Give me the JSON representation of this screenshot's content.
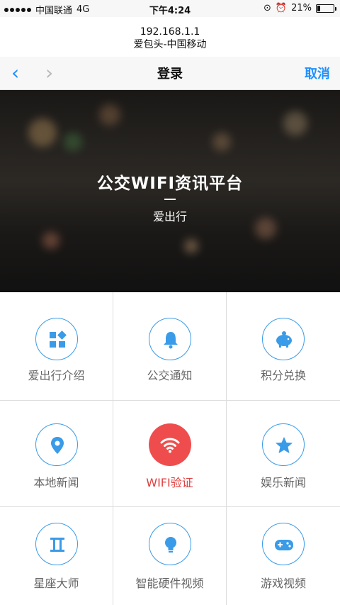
{
  "status": {
    "carrier": "中国联通",
    "network": "4G",
    "time": "下午4:24",
    "battery": "21%",
    "battery_level": 0.21
  },
  "address": {
    "host": "192.168.1.1",
    "site": "爱包头-中国移动"
  },
  "nav": {
    "back": "‹",
    "forward": "›",
    "title": "登录",
    "cancel": "取消"
  },
  "banner": {
    "title": "公交WIFI资讯平台",
    "subtitle": "爱出行"
  },
  "grid": [
    {
      "label": "爱出行介绍",
      "icon": "apps-icon"
    },
    {
      "label": "公交通知",
      "icon": "bell-icon"
    },
    {
      "label": "积分兑换",
      "icon": "piggy-bank-icon"
    },
    {
      "label": "本地新闻",
      "icon": "location-pin-icon"
    },
    {
      "label": "WIFI验证",
      "icon": "wifi-icon"
    },
    {
      "label": "娱乐新闻",
      "icon": "star-icon"
    },
    {
      "label": "星座大师",
      "icon": "gemini-icon"
    },
    {
      "label": "智能硬件视频",
      "icon": "lightbulb-icon"
    },
    {
      "label": "游戏视频",
      "icon": "gamepad-icon"
    }
  ],
  "colors": {
    "accent": "#1e90ff",
    "icon_blue": "#3a9be8",
    "wifi_red": "#ef4d4d"
  }
}
